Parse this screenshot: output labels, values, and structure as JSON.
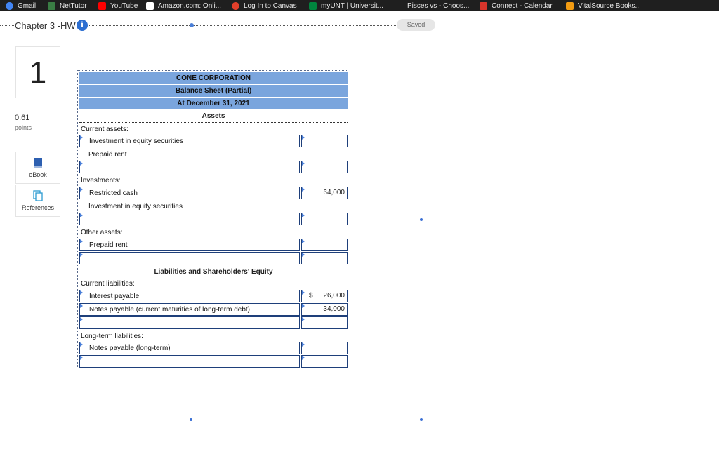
{
  "bookmarks": [
    {
      "label": "Gmail",
      "icon": "google-icon",
      "color": "#4285f4"
    },
    {
      "label": "NetTutor",
      "icon": "nettutor-icon",
      "color": "#3a7d44"
    },
    {
      "label": "YouTube",
      "icon": "youtube-icon",
      "color": "#ff0000"
    },
    {
      "label": "Amazon.com: Onli...",
      "icon": "amazon-icon",
      "color": "#ffffff"
    },
    {
      "label": "Log In to Canvas",
      "icon": "canvas-icon",
      "color": "#e13f2b"
    },
    {
      "label": "myUNT | Universit...",
      "icon": "unt-icon",
      "color": "#00853e"
    },
    {
      "label": "Pisces vs - Choos...",
      "icon": "page-icon",
      "color": "#1f1f1f"
    },
    {
      "label": "Connect - Calendar",
      "icon": "connect-icon",
      "color": "#d9352b"
    },
    {
      "label": "VitalSource Books...",
      "icon": "vitalsource-icon",
      "color": "#f39c12"
    }
  ],
  "header": {
    "chapter": "Chapter 3 -HW",
    "saved": "Saved"
  },
  "question": {
    "number": "1",
    "points_value": "0.61",
    "points_label": "points"
  },
  "sidebar": {
    "ebook": "eBook",
    "references": "References"
  },
  "sheet": {
    "company": "CONE CORPORATION",
    "title": "Balance Sheet (Partial)",
    "date": "At December 31, 2021",
    "assets": "Assets",
    "current_assets": "Current assets:",
    "ca_item1": "Investment in equity securities",
    "ca_item2": "Prepaid rent",
    "investments": "Investments:",
    "inv_item1": "Restricted cash",
    "inv_item1_value": "64,000",
    "inv_item2": "Investment in equity securities",
    "other_assets": "Other assets:",
    "oa_item1": "Prepaid rent",
    "liab_heading": "Liabilities and Shareholders' Equity",
    "current_liabilities": "Current liabilities:",
    "cl_item1": "Interest payable",
    "cl_item1_dollar": "$",
    "cl_item1_value": "26,000",
    "cl_item2": "Notes payable (current maturities of long-term debt)",
    "cl_item2_value": "34,000",
    "longterm_liabilities": "Long-term liabilities:",
    "lt_item1": "Notes payable (long-term)"
  }
}
